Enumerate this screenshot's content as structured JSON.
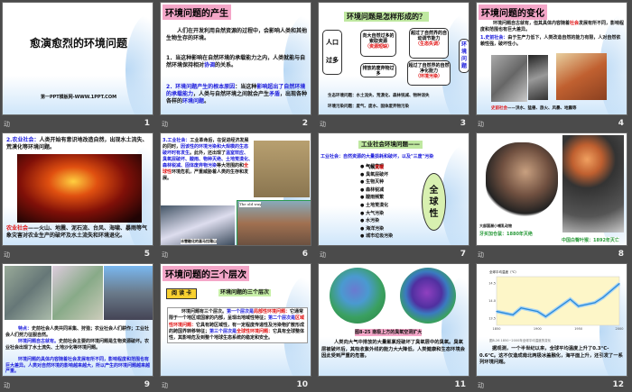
{
  "slides": [
    {
      "num": "1",
      "title": "愈演愈烈的环境问题",
      "footer": "第一PPT模板网-WWW.1PPT.COM"
    },
    {
      "num": "2",
      "heading": "环境问题的产生",
      "p1": "人们在开发利用自然资源的过程中，会影响人类和其他生物生存的环境。",
      "p2a": "1．当这种影响在自然环境的承载能力之内，人类就能与自然环境保持相对",
      "p2b": "协调",
      "p2c": "的关系。",
      "p3a": "2．环境问题产生的根本原因",
      "p3b": "：当这种",
      "p3c": "影响超出了自然环境的承载能力",
      "p3d": "，人类与自然环境之间就会产生",
      "p3e": "矛盾",
      "p3f": "，出现各种各样的",
      "p3g": "环境问题",
      "p3h": "。"
    },
    {
      "num": "3",
      "heading": "环境问题是怎样形成的？",
      "left1": "人口",
      "left2": "过多",
      "b1": "向大自然过多的索取资源",
      "b1r": "（资源短缺）",
      "b2": "排放的废弃物过多",
      "b3": "超过了自然界的自动调节能力",
      "b3r": "（生态失调）",
      "b4": "超过了自然界的自然净化能力",
      "b4r": "（环境污染）",
      "side": "环境问题",
      "l1": "生态环境问题：水土流失、荒漠化、森林锐减、物种消失",
      "l2": "环境污染问题：废气、废水、固体废弃物污染"
    },
    {
      "num": "4",
      "heading": "环境问题的变化",
      "p1a": "环境问题自古就有，但其具体内容随着",
      "p1b": "社会",
      "p1c": "发展有所不同，影响程度和范围也有巨大差异。",
      "p2a": "1.史前社会：",
      "p2b": "由于生产力低下，人类改造自然的能力有限，人对自然依赖性强，破坏性小。",
      "cap1": "史前社会",
      "cap2": "——洪水、猛兽、旅火、风暴、地震等"
    },
    {
      "num": "5",
      "p1a": "2.农业社会：",
      "p1b": "人类开始有意识地改造自然，出现水土流失、荒漠化等环境问题。",
      "p2a": "农业社会",
      "p2b": "——火山、地震、泥石流、台风、海啸、暴雨等气象灾害对农业生产的破坏及水土流失和环境退化。"
    },
    {
      "num": "6",
      "p1a": "3.工业社会：",
      "p1b": "工业革命后，在促进经济发展的同时，",
      "p1c": "因该性的环境污染和大规模的生态破坏时有发生",
      "p1d": "。此外，还出现了",
      "p1e": "温室效应、臭氧层破坏、酸雨、物种灭绝、土地荒漠化、森林锐减、固体废弃物污染",
      "p1f": "等大范围的和",
      "p1g": "全球性",
      "p1h": "环境危机，严重威胁着人类的生存和发展。",
      "cap1": "冰雪融化的喜马拉雅山",
      "cap2": "The old way"
    },
    {
      "num": "7",
      "heading": "工业社会环境问题——",
      "sub": "工业社会：自然资源的大量损耗和破坏，以及\"三废\"污染",
      "items": [
        "气候变暖",
        "臭氧层破坏",
        "生物灭种",
        "森林锐减",
        "酸雨频繁",
        "土地荒漠化",
        "大气污染",
        "水污染",
        "海洋污染",
        "城市垃圾污染"
      ],
      "item0a": "气候",
      "item0b": "变暖",
      "oval": "全球性"
    },
    {
      "num": "8",
      "cap1": "牙买加仓鼠：1880年灭绝",
      "cap2": "中国白臀叶猴：1892年灭亡",
      "cap3": "大部国濒小哺乳动物"
    },
    {
      "num": "9",
      "p1a": "特点：",
      "p1b": "史前社会人类共同采集、狩猎；农业社会人们耕作；工业社会人们努力征服自然。",
      "p2a": "环境问题自古就有。",
      "p2b": "史前社会主要的环境问题是生物资源破坏。农业社会出现了水土流失、土地沙化等环境问题。",
      "p3": "环境问题的具体内容随着社会发展有所不同，影响程度和范围也有巨大差异。人类对自然环境的影响越来越大，所以产生的环境问题越来越严重。"
    },
    {
      "num": "10",
      "heading": "环境问题的三个层次",
      "card": "阅 读 卡",
      "subtitle": "环境问题的三个层次",
      "t1": "环境问题有三个层次。",
      "t2": "第一个层次是",
      "t3": "局部性环境问题：",
      "t4": "它通常限于一个地区或国家的内部，呈现出地域性特征；",
      "t5": "第二个层次是",
      "t6": "区域性环境问题：",
      "t7": "它具有跨区域性，有一定程度传递性及污染物扩散形成的跨国界转移特征；",
      "t8": "第三个层次是",
      "t9": "全球性环境问题：",
      "t10": "它具有全球整体性，其影响危及到整个地球生态系统的稳定和安全。"
    },
    {
      "num": "11",
      "caption": "图8-25 南极上方的臭氧空洞扩大",
      "p": "人类向大气中排放的大量氟氯烃破坏了臭氧层中的臭氧。臭氧层被破坏后，其吸收紫外线的能力大大降低，人类健康和生态环境会因此受到严重的危害。"
    },
    {
      "num": "12",
      "ylabel": "全球平均温度（℃）",
      "caption": "图8-26 1850~2000年全球平均温度的变化",
      "p": "据观测，一个半世纪以来，全球平均温度上升了0.3°C-0.6°C。这不仅造成南北两极冰盖融化，海平面上升，还引发了一系列环境问题。"
    }
  ],
  "anim_icon": "动",
  "chart_data": {
    "type": "line",
    "title": "全球平均温度（℃）",
    "xlabel": "年",
    "x": [
      1850,
      1870,
      1880,
      1900,
      1910,
      1940,
      1950,
      1970,
      1980,
      2000
    ],
    "y": [
      13.7,
      13.6,
      13.8,
      13.7,
      13.55,
      14.05,
      13.85,
      13.95,
      14.1,
      14.5
    ],
    "xticks": [
      "1850",
      "1900",
      "1950",
      "2000"
    ],
    "yticks": [
      "13.5",
      "14.0",
      "14.5"
    ],
    "ylim": [
      13.3,
      14.7
    ]
  },
  "colors": {
    "background": "#4b4b4b",
    "pink_heading": "#f4a6c8",
    "blue_text": "#1a1adb",
    "red_text": "#e01010"
  }
}
